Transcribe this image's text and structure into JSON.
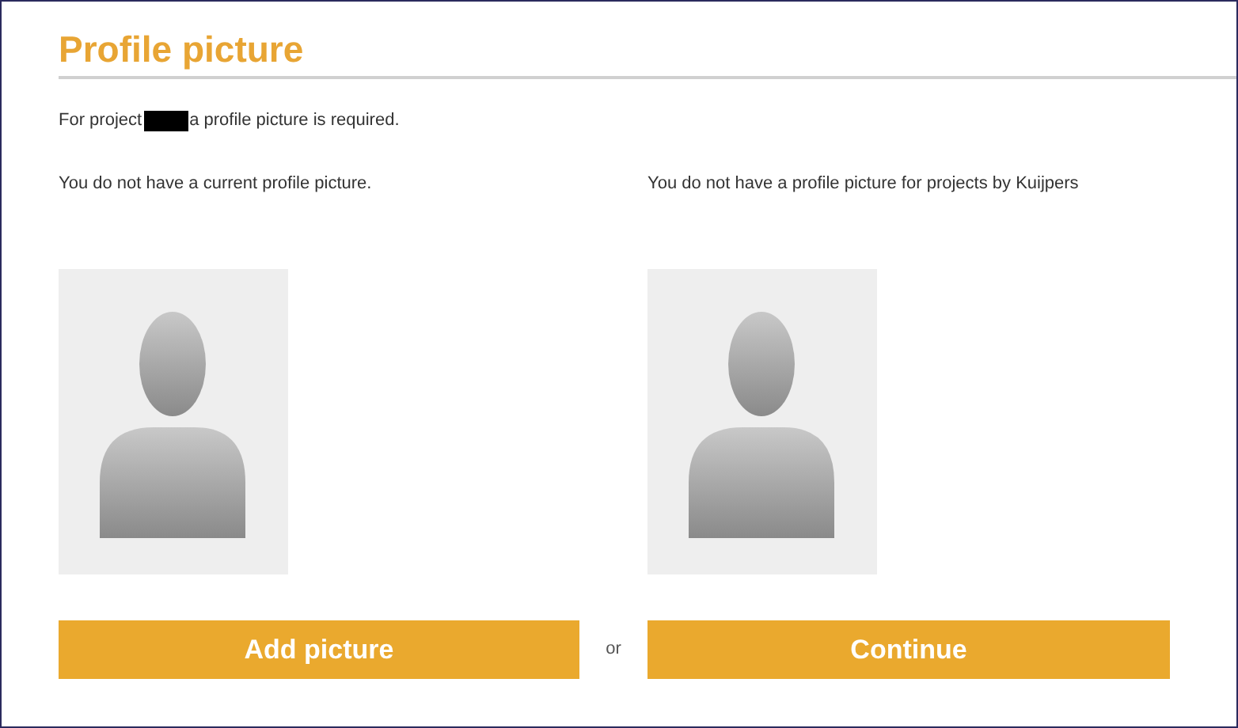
{
  "title": "Profile picture",
  "notice": {
    "before": "For project",
    "redacted": true,
    "after": "a profile picture is required."
  },
  "columns": [
    {
      "message": "You do not have a current profile picture.",
      "avatar": {
        "kind": "placeholder"
      },
      "button": "Add picture"
    },
    {
      "message": "You do not have a profile picture for projects by Kuijpers",
      "avatar": {
        "kind": "placeholder"
      },
      "button": "Continue"
    }
  ],
  "separator": "or"
}
